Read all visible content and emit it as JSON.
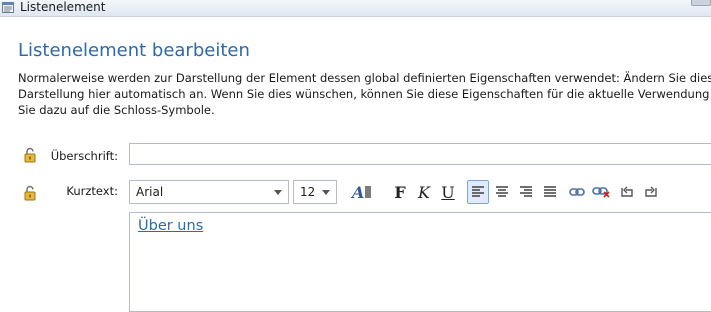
{
  "window": {
    "title": "Listenelement"
  },
  "heading": "Listenelement bearbeiten",
  "description_lines": [
    "Normalerweise werden zur Darstellung der Element dessen global definierten Eigenschaften verwendet: Ändern Sie diese, passt sich",
    "Darstellung hier automatisch an. Wenn Sie dies wünschen, können Sie diese Eigenschaften für die aktuelle Verwendung überschreib",
    "Sie dazu auf die Schloss-Symbole."
  ],
  "fields": {
    "ueberschrift_label": "Überschrift:",
    "ueberschrift_value": "",
    "kurztext_label": "Kurztext:"
  },
  "toolbar": {
    "font_family": "Arial",
    "font_size": "12",
    "bold_label": "F",
    "italic_label": "K",
    "underline_label": "U"
  },
  "editor": {
    "content_link": "Über uns"
  },
  "icons": {
    "lock": "lock-open-icon",
    "text_color": "text-color-icon",
    "align": [
      "align-left-icon",
      "align-center-icon",
      "align-right-icon",
      "align-justify-icon"
    ],
    "link": "insert-link-icon",
    "unlink": "remove-link-icon",
    "undo": "undo-icon",
    "redo": "redo-icon"
  },
  "colors": {
    "heading": "#2e6aa6",
    "link": "#2e6aa6"
  }
}
